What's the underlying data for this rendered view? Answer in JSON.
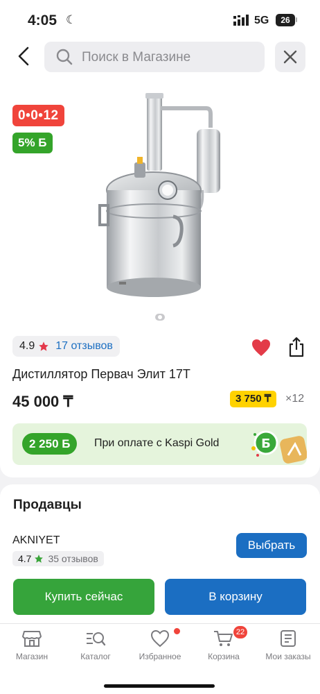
{
  "status_bar": {
    "time": "4:05",
    "network": "5G",
    "battery": "26"
  },
  "search": {
    "placeholder": "Поиск в Магазине"
  },
  "product": {
    "installment_badge": "0•0•12",
    "bonus_badge": "5% Б",
    "rating": "4.9",
    "reviews": "17 отзывов",
    "title": "Дистиллятор Первач Элит 17Т",
    "price": "45 000 ₸",
    "monthly_payment": "3 750 ₸",
    "months": "×12",
    "gold_amount": "2 250 Б",
    "gold_text": "При оплате с Kaspi Gold",
    "image_count": 1,
    "current_image": 1
  },
  "sellers": {
    "title": "Продавцы",
    "items": [
      {
        "name": "AKNIYET",
        "rating": "4.7",
        "reviews": "35 отзывов",
        "button": "Выбрать"
      }
    ]
  },
  "actions": {
    "buy_now": "Купить сейчас",
    "add_to_cart": "В корзину"
  },
  "tabs": [
    {
      "label": "Магазин",
      "icon": "store-icon"
    },
    {
      "label": "Каталог",
      "icon": "catalog-search-icon"
    },
    {
      "label": "Избранное",
      "icon": "heart-icon",
      "dot": true
    },
    {
      "label": "Корзина",
      "icon": "cart-icon",
      "badge": "22"
    },
    {
      "label": "Мои заказы",
      "icon": "orders-icon"
    }
  ],
  "colors": {
    "accent_blue": "#1b6ec2",
    "accent_green": "#36a43b",
    "badge_red": "#f0443b",
    "yellow": "#ffd200",
    "favorite_heart": "#e33b48"
  }
}
